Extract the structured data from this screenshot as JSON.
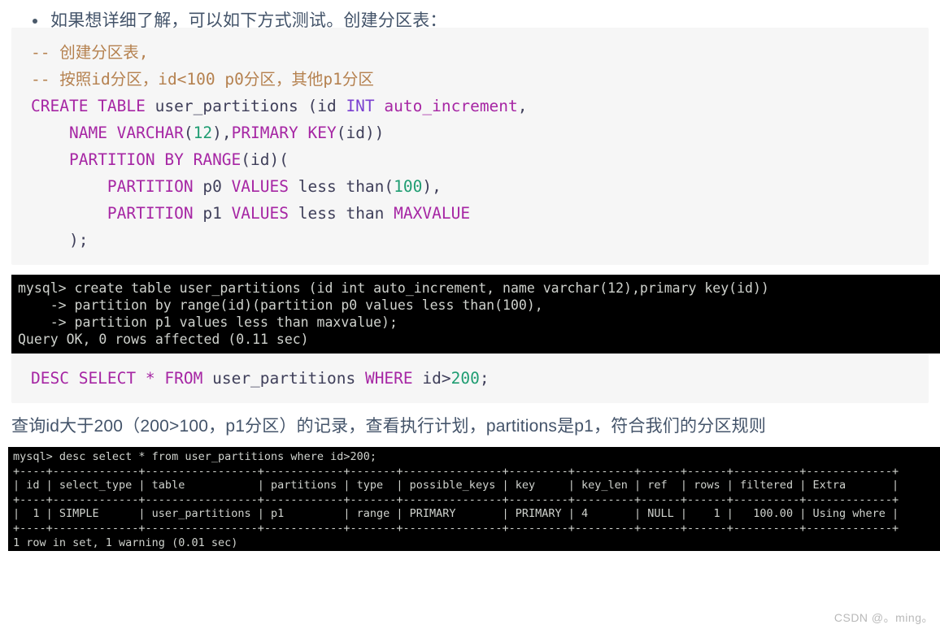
{
  "intro": {
    "bullet_text": "如果想详细了解，可以如下方式测试。创建分区表："
  },
  "code_block_1": {
    "language": "sql",
    "lines": [
      [
        {
          "t": "-- 创建分区表,",
          "c": "cm"
        }
      ],
      [
        {
          "t": "-- 按照id分区，id<100 p0分区，其他p1分区",
          "c": "cm"
        }
      ],
      [
        {
          "t": "CREATE TABLE",
          "c": "k"
        },
        {
          "t": " user_partitions (id ",
          "c": "pl"
        },
        {
          "t": "INT",
          "c": "ty"
        },
        {
          "t": " ",
          "c": "pl"
        },
        {
          "t": "auto_increment",
          "c": "k"
        },
        {
          "t": ",",
          "c": "pl"
        }
      ],
      [
        {
          "t": "    ",
          "c": "pl"
        },
        {
          "t": "NAME VARCHAR",
          "c": "k"
        },
        {
          "t": "(",
          "c": "pl"
        },
        {
          "t": "12",
          "c": "num"
        },
        {
          "t": "),",
          "c": "pl"
        },
        {
          "t": "PRIMARY KEY",
          "c": "k"
        },
        {
          "t": "(id))",
          "c": "pl"
        }
      ],
      [
        {
          "t": "    ",
          "c": "pl"
        },
        {
          "t": "PARTITION BY RANGE",
          "c": "k"
        },
        {
          "t": "(id)(",
          "c": "pl"
        }
      ],
      [
        {
          "t": "        ",
          "c": "pl"
        },
        {
          "t": "PARTITION",
          "c": "k"
        },
        {
          "t": " p0 ",
          "c": "pl"
        },
        {
          "t": "VALUES",
          "c": "k"
        },
        {
          "t": " less than(",
          "c": "pl"
        },
        {
          "t": "100",
          "c": "num"
        },
        {
          "t": "),",
          "c": "pl"
        }
      ],
      [
        {
          "t": "        ",
          "c": "pl"
        },
        {
          "t": "PARTITION",
          "c": "k"
        },
        {
          "t": " p1 ",
          "c": "pl"
        },
        {
          "t": "VALUES",
          "c": "k"
        },
        {
          "t": " less than ",
          "c": "pl"
        },
        {
          "t": "MAXVALUE",
          "c": "k"
        }
      ],
      [
        {
          "t": "    );",
          "c": "pl"
        }
      ]
    ]
  },
  "terminal_1": {
    "lines": [
      "mysql> create table user_partitions (id int auto_increment, name varchar(12),primary key(id))",
      "    -> partition by range(id)(partition p0 values less than(100),",
      "    -> partition p1 values less than maxvalue);",
      "Query OK, 0 rows affected (0.11 sec)"
    ]
  },
  "code_block_2": {
    "language": "sql",
    "lines": [
      [
        {
          "t": "DESC SELECT",
          "c": "k"
        },
        {
          "t": " ",
          "c": "pl"
        },
        {
          "t": "*",
          "c": "k"
        },
        {
          "t": " ",
          "c": "pl"
        },
        {
          "t": "FROM",
          "c": "k"
        },
        {
          "t": " user_partitions ",
          "c": "pl"
        },
        {
          "t": "WHERE",
          "c": "k"
        },
        {
          "t": " id>",
          "c": "pl"
        },
        {
          "t": "200",
          "c": "num"
        },
        {
          "t": ";",
          "c": "pl"
        }
      ]
    ]
  },
  "explanation": {
    "text": "查询id大于200（200>100，p1分区）的记录，查看执行计划，partitions是p1，符合我们的分区规则"
  },
  "terminal_2": {
    "prompt_line": "mysql> desc select * from user_partitions where id>200;",
    "separator": "+----+-------------+-----------------+------------+-------+---------------+---------+---------+------+------+----------+-------------+",
    "header_row": "| id | select_type | table           | partitions | type  | possible_keys | key     | key_len | ref  | rows | filtered | Extra       |",
    "data_row": "|  1 | SIMPLE      | user_partitions | p1         | range | PRIMARY       | PRIMARY | 4       | NULL |    1 |   100.00 | Using where |",
    "footer_line": "1 row in set, 1 warning (0.01 sec)",
    "columns": [
      "id",
      "select_type",
      "table",
      "partitions",
      "type",
      "possible_keys",
      "key",
      "key_len",
      "ref",
      "rows",
      "filtered",
      "Extra"
    ],
    "row_values": [
      "1",
      "SIMPLE",
      "user_partitions",
      "p1",
      "range",
      "PRIMARY",
      "PRIMARY",
      "4",
      "NULL",
      "1",
      "100.00",
      "Using where"
    ]
  },
  "watermark": {
    "text": "CSDN @。ming。"
  },
  "colors": {
    "keyword": "#a626a4",
    "type": "#7a3fd0",
    "comment": "#b5814f",
    "number": "#1f9d72",
    "code_bg": "#f6f6f6",
    "terminal_bg": "#000000",
    "terminal_fg": "#cfd2cd",
    "body_text": "#44546a"
  }
}
